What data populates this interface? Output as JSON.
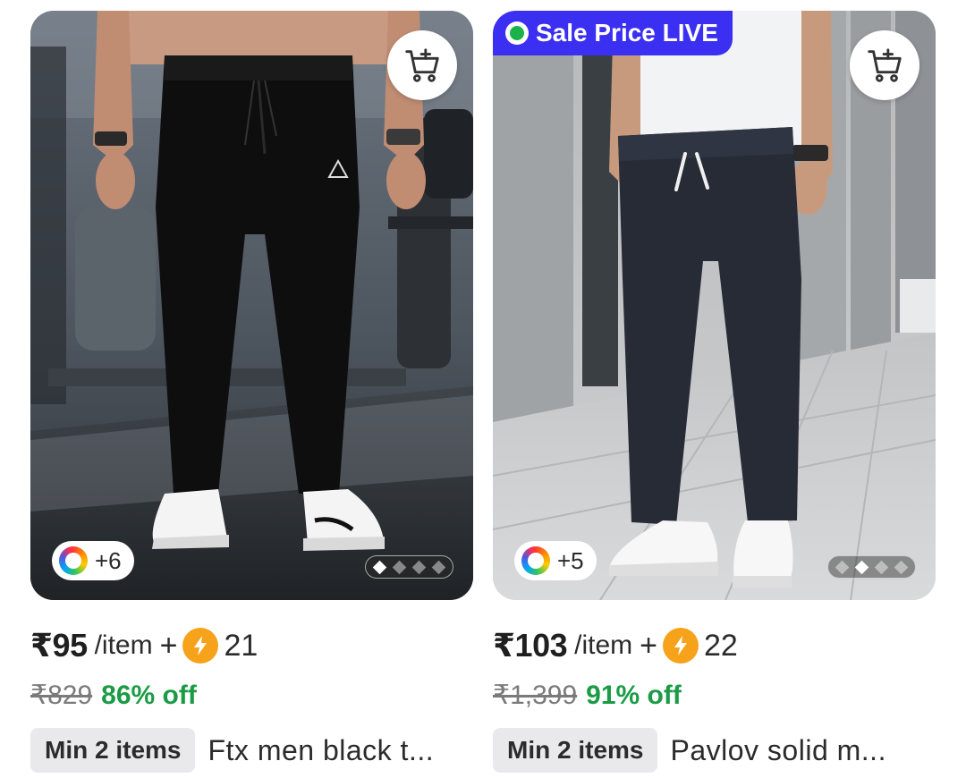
{
  "products": [
    {
      "price": "₹95",
      "per_item": "/item",
      "plus": "+",
      "coins": "21",
      "mrp": "₹829",
      "discount": "86% off",
      "min_items": "Min 2 items",
      "title": "Ftx men black t...",
      "variants": "+6",
      "sale_badge": "",
      "image_dots": {
        "count": 4,
        "active": 1
      },
      "image_icon": "black-track-pants-photo"
    },
    {
      "price": "₹103",
      "per_item": "/item",
      "plus": "+",
      "coins": "22",
      "mrp": "₹1,399",
      "discount": "91% off",
      "min_items": "Min 2 items",
      "title": "Pavlov solid m...",
      "variants": "+5",
      "sale_badge": "Sale Price LIVE",
      "image_dots": {
        "count": 4,
        "active": 2
      },
      "image_icon": "navy-trousers-photo"
    }
  ],
  "colors": {
    "discount_green": "#1b9b45",
    "sale_badge_blue": "#3b2ff2",
    "coin_orange": "#f7a21b",
    "chip_gray": "#e9e9ec"
  },
  "icons": [
    "add-to-cart-icon",
    "color-variants-icon",
    "lightning-coin-icon",
    "live-dot-icon"
  ]
}
